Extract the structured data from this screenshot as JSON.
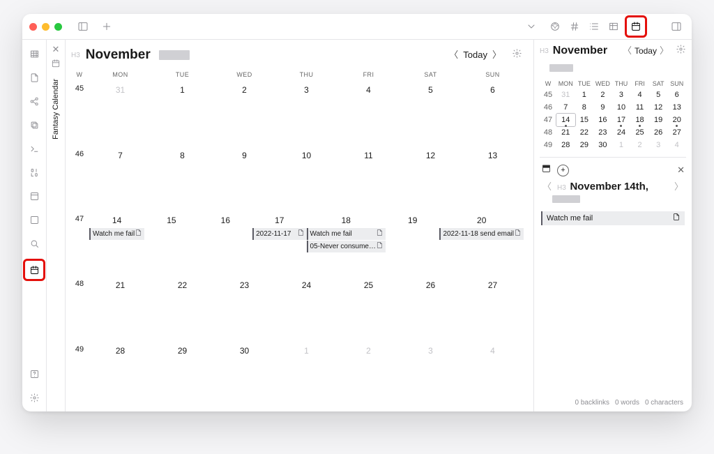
{
  "tabTitle": "Fantasy Calendar",
  "main": {
    "prefix": "H3",
    "title": "November",
    "todayLabel": "Today",
    "dow": [
      "W",
      "MON",
      "TUE",
      "WED",
      "THU",
      "FRI",
      "SAT",
      "SUN"
    ],
    "weeks": [
      {
        "w": "45",
        "days": [
          {
            "n": "31",
            "muted": true
          },
          {
            "n": "1"
          },
          {
            "n": "2"
          },
          {
            "n": "3"
          },
          {
            "n": "4"
          },
          {
            "n": "5"
          },
          {
            "n": "6"
          }
        ]
      },
      {
        "w": "46",
        "days": [
          {
            "n": "7"
          },
          {
            "n": "8"
          },
          {
            "n": "9"
          },
          {
            "n": "10"
          },
          {
            "n": "11"
          },
          {
            "n": "12"
          },
          {
            "n": "13"
          }
        ]
      },
      {
        "w": "47",
        "days": [
          {
            "n": "14",
            "events": [
              "Watch me fail"
            ]
          },
          {
            "n": "15"
          },
          {
            "n": "16"
          },
          {
            "n": "17",
            "events": [
              "2022-11-17"
            ]
          },
          {
            "n": "18",
            "events": [
              "Watch me fail",
              "05-Never consume…"
            ]
          },
          {
            "n": "19"
          },
          {
            "n": "20",
            "events": [
              "2022-11-18 send email"
            ]
          }
        ]
      },
      {
        "w": "48",
        "days": [
          {
            "n": "21"
          },
          {
            "n": "22"
          },
          {
            "n": "23"
          },
          {
            "n": "24"
          },
          {
            "n": "25"
          },
          {
            "n": "26"
          },
          {
            "n": "27"
          }
        ]
      },
      {
        "w": "49",
        "days": [
          {
            "n": "28"
          },
          {
            "n": "29"
          },
          {
            "n": "30"
          },
          {
            "n": "1",
            "muted": true
          },
          {
            "n": "2",
            "muted": true
          },
          {
            "n": "3",
            "muted": true
          },
          {
            "n": "4",
            "muted": true
          }
        ]
      }
    ]
  },
  "side": {
    "prefix": "H3",
    "title": "November",
    "todayLabel": "Today",
    "dow": [
      "W",
      "MON",
      "TUE",
      "WED",
      "THU",
      "FRI",
      "SAT",
      "SUN"
    ],
    "rows": [
      {
        "w": "45",
        "d": [
          {
            "n": "31",
            "muted": true
          },
          {
            "n": "1"
          },
          {
            "n": "2"
          },
          {
            "n": "3"
          },
          {
            "n": "4"
          },
          {
            "n": "5"
          },
          {
            "n": "6"
          }
        ]
      },
      {
        "w": "46",
        "d": [
          {
            "n": "7"
          },
          {
            "n": "8"
          },
          {
            "n": "9"
          },
          {
            "n": "10"
          },
          {
            "n": "11"
          },
          {
            "n": "12"
          },
          {
            "n": "13"
          }
        ]
      },
      {
        "w": "47",
        "d": [
          {
            "n": "14",
            "sel": true,
            "dot": true
          },
          {
            "n": "15"
          },
          {
            "n": "16"
          },
          {
            "n": "17",
            "dot": true
          },
          {
            "n": "18",
            "dot": true
          },
          {
            "n": "19"
          },
          {
            "n": "20",
            "dot": true
          }
        ]
      },
      {
        "w": "48",
        "d": [
          {
            "n": "21"
          },
          {
            "n": "22"
          },
          {
            "n": "23"
          },
          {
            "n": "24"
          },
          {
            "n": "25"
          },
          {
            "n": "26"
          },
          {
            "n": "27"
          }
        ]
      },
      {
        "w": "49",
        "d": [
          {
            "n": "28"
          },
          {
            "n": "29"
          },
          {
            "n": "30"
          },
          {
            "n": "1",
            "muted": true
          },
          {
            "n": "2",
            "muted": true
          },
          {
            "n": "3",
            "muted": true
          },
          {
            "n": "4",
            "muted": true
          }
        ]
      }
    ],
    "detail": {
      "prefix": "H3",
      "title": "November 14th,",
      "event": "Watch me fail"
    },
    "status": {
      "backlinks": "0 backlinks",
      "words": "0 words",
      "chars": "0 characters"
    }
  }
}
